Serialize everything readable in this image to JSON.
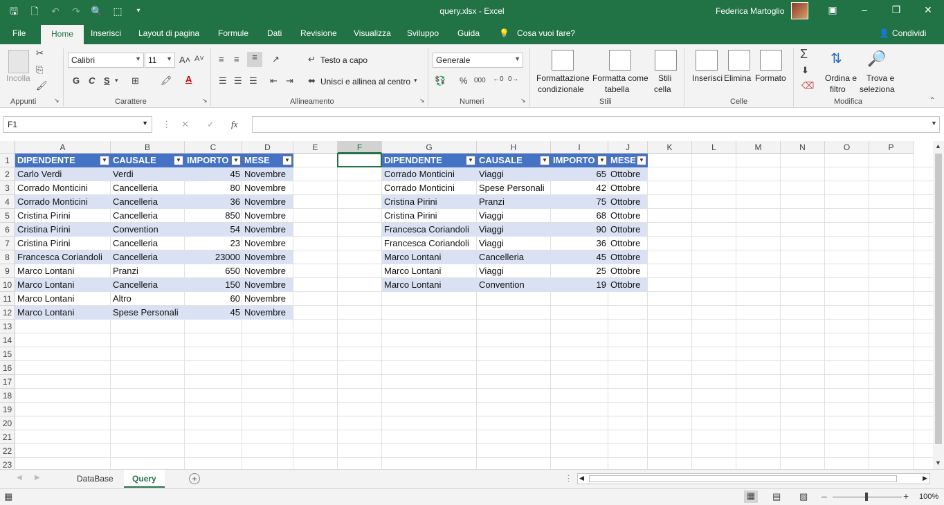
{
  "window": {
    "title": "query.xlsx  -  Excel",
    "user": "Federica Martoglio"
  },
  "ribbon_tabs": [
    "File",
    "Home",
    "Inserisci",
    "Layout di pagina",
    "Formule",
    "Dati",
    "Revisione",
    "Visualizza",
    "Sviluppo",
    "Guida"
  ],
  "tell_me": "Cosa vuoi fare?",
  "share": "Condividi",
  "ribbon": {
    "paste": "Incolla",
    "font_name": "Calibri",
    "font_size": "11",
    "bold": "G",
    "italic": "C",
    "underline": "S",
    "wrap_text": "Testo a capo",
    "merge_center": "Unisci e allinea al centro",
    "number_format": "Generale",
    "percent": "%",
    "thousands": "000",
    "cond_format_1": "Formattazione",
    "cond_format_2": "condizionale",
    "format_table_1": "Formatta come",
    "format_table_2": "tabella",
    "cell_styles_1": "Stili",
    "cell_styles_2": "cella",
    "insert": "Inserisci",
    "delete": "Elimina",
    "format": "Formato",
    "sort_1": "Ordina e",
    "sort_2": "filtro",
    "find_1": "Trova e",
    "find_2": "seleziona",
    "groups": [
      "Appunti",
      "Carattere",
      "Allineamento",
      "Numeri",
      "Stili",
      "Celle",
      "Modifica"
    ]
  },
  "name_box": "F1",
  "fx": "fx",
  "columns": [
    "A",
    "B",
    "C",
    "D",
    "E",
    "F",
    "G",
    "H",
    "I",
    "J",
    "K",
    "L",
    "M",
    "N",
    "O",
    "P"
  ],
  "rows": [
    "1",
    "2",
    "3",
    "4",
    "5",
    "6",
    "7",
    "8",
    "9",
    "10",
    "11",
    "12",
    "13",
    "14",
    "15",
    "16",
    "17",
    "18",
    "19",
    "20",
    "21",
    "22",
    "23"
  ],
  "table1": {
    "headers": [
      "DIPENDENTE",
      "CAUSALE",
      "IMPORTO",
      "MESE"
    ],
    "rows": [
      [
        "Carlo Verdi",
        "Verdi",
        "45",
        "Novembre"
      ],
      [
        "Corrado Monticini",
        "Cancelleria",
        "80",
        "Novembre"
      ],
      [
        "Corrado Monticini",
        "Cancelleria",
        "36",
        "Novembre"
      ],
      [
        "Cristina Pirini",
        "Cancelleria",
        "850",
        "Novembre"
      ],
      [
        "Cristina Pirini",
        "Convention",
        "54",
        "Novembre"
      ],
      [
        "Cristina Pirini",
        "Cancelleria",
        "23",
        "Novembre"
      ],
      [
        "Francesca Coriandoli",
        "Cancelleria",
        "23000",
        "Novembre"
      ],
      [
        "Marco Lontani",
        "Pranzi",
        "650",
        "Novembre"
      ],
      [
        "Marco Lontani",
        "Cancelleria",
        "150",
        "Novembre"
      ],
      [
        "Marco Lontani",
        "Altro",
        "60",
        "Novembre"
      ],
      [
        "Marco Lontani",
        "Spese Personali",
        "45",
        "Novembre"
      ]
    ]
  },
  "table2": {
    "headers": [
      "DIPENDENTE",
      "CAUSALE",
      "IMPORTO",
      "MESE"
    ],
    "rows": [
      [
        "Corrado Monticini",
        "Viaggi",
        "65",
        "Ottobre"
      ],
      [
        "Corrado Monticini",
        "Spese Personali",
        "42",
        "Ottobre"
      ],
      [
        "Cristina Pirini",
        "Pranzi",
        "75",
        "Ottobre"
      ],
      [
        "Cristina Pirini",
        "Viaggi",
        "68",
        "Ottobre"
      ],
      [
        "Francesca Coriandoli",
        "Viaggi",
        "90",
        "Ottobre"
      ],
      [
        "Francesca Coriandoli",
        "Viaggi",
        "36",
        "Ottobre"
      ],
      [
        "Marco Lontani",
        "Cancelleria",
        "45",
        "Ottobre"
      ],
      [
        "Marco Lontani",
        "Viaggi",
        "25",
        "Ottobre"
      ],
      [
        "Marco Lontani",
        "Convention",
        "19",
        "Ottobre"
      ]
    ]
  },
  "sheets": [
    "DataBase",
    "Query"
  ],
  "active_sheet": "Query",
  "zoom": "100%"
}
